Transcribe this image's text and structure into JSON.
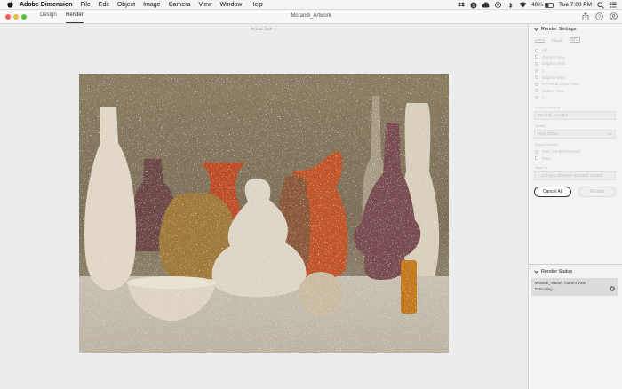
{
  "menubar": {
    "app_name": "Adobe Dimension",
    "items": [
      "File",
      "Edit",
      "Object",
      "Image",
      "Camera",
      "View",
      "Window",
      "Help"
    ],
    "battery": "40%",
    "clock": "Tue 7:00 PM",
    "icons": [
      "apple-icon",
      "dropbox-icon",
      "skype-icon",
      "creative-cloud-icon",
      "bluetooth-icon",
      "wifi-icon",
      "battery-icon",
      "spotlight-icon",
      "notification-center-icon"
    ]
  },
  "titlebar": {
    "tabs": [
      "Design",
      "Render"
    ],
    "active_tab": "Render",
    "doc_title": "Morandi_Artwork",
    "icons": [
      "share-icon",
      "help-icon",
      "profile-icon"
    ]
  },
  "canvas": {
    "view_size": "Actual Size ⌄",
    "image_alt": "Rendered still life of Morandi style vases and bottles"
  },
  "render_settings": {
    "title": "Render Settings",
    "subtabs": [
      "Local",
      "Cloud"
    ],
    "beta": "BETA",
    "view_options": [
      "All",
      "Current View",
      "Original View",
      "1",
      "Original View",
      "3-Frontal Close View",
      "Hidden View",
      "1"
    ],
    "selected_view": "Current View",
    "export_filename_label": "Export Filename",
    "export_filename": "Morandi_Artwork",
    "quality_label": "Quality",
    "quality": "High (Slow)",
    "export_format_label": "Export Format",
    "formats": [
      "PSD (16 Bit/Channel)",
      "PNG"
    ],
    "save_to_label": "Save To",
    "save_to": "...ns/Port Lif/Design Morandi Tutorial",
    "cancel_all": "Cancel All",
    "render": "Render"
  },
  "render_status": {
    "title": "Render Status",
    "job_name": "Morandi_Artwork Current View",
    "state": "Estimating..."
  },
  "colors": {
    "accent_dark": "#333333",
    "panel_bg": "#f3f3f3",
    "canvas_bg": "#ececec"
  }
}
